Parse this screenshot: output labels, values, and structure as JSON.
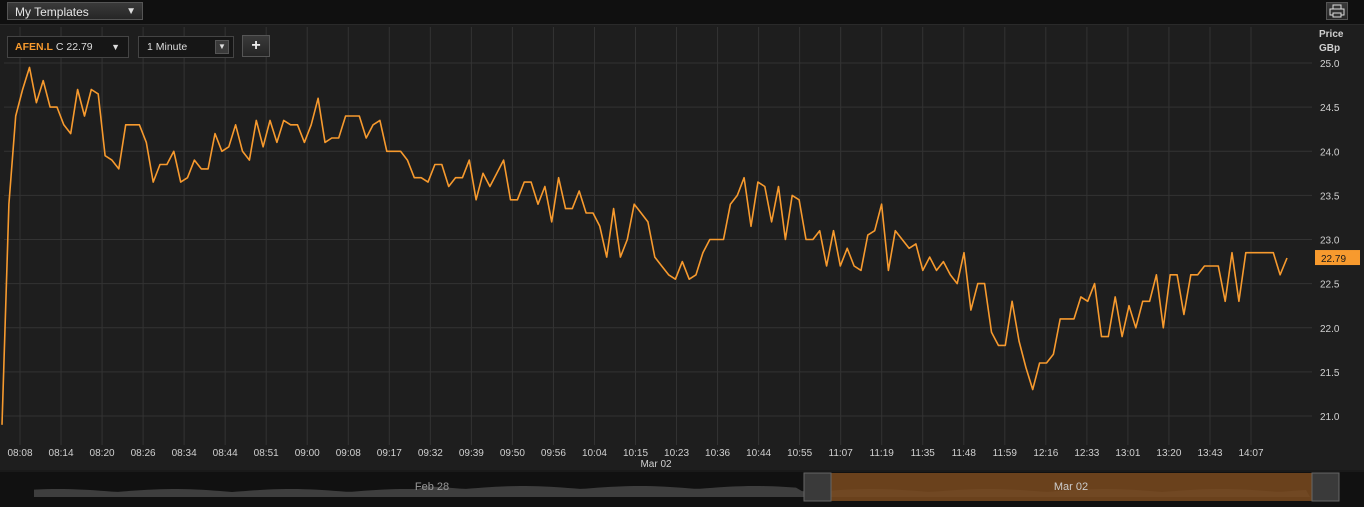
{
  "toolbar": {
    "template_label": "My Templates"
  },
  "instrument": {
    "ric": "AFEN.L",
    "close_prefix": "C",
    "close_value": "22.79"
  },
  "interval": {
    "label": "1 Minute"
  },
  "colors": {
    "line": "#f79a2e",
    "background": "#1e1e1e",
    "grid": "#333333",
    "navigator_selected": "#7a4a1e"
  },
  "chart_data": {
    "type": "line",
    "yaxis_label_1": "Price",
    "yaxis_label_2": "GBp",
    "ylim": [
      20.8,
      25.1
    ],
    "yticks": [
      "25.0",
      "24.5",
      "24.0",
      "23.5",
      "23.0",
      "22.5",
      "22.0",
      "21.5",
      "21.0"
    ],
    "last_value_label": "22.79",
    "last_value": 22.79,
    "xticks": [
      "08:08",
      "08:14",
      "08:20",
      "08:26",
      "08:34",
      "08:44",
      "08:51",
      "09:00",
      "09:08",
      "09:17",
      "09:32",
      "09:39",
      "09:50",
      "09:56",
      "10:04",
      "10:15",
      "10:23",
      "10:36",
      "10:44",
      "10:55",
      "11:07",
      "11:19",
      "11:35",
      "11:48",
      "11:59",
      "12:16",
      "12:33",
      "13:01",
      "13:20",
      "13:43",
      "14:07"
    ],
    "date_label": "Mar 02",
    "series": [
      {
        "values": [
          20.9,
          23.4,
          24.4,
          24.7,
          24.95,
          24.55,
          24.8,
          24.5,
          24.5,
          24.3,
          24.2,
          24.7,
          24.4,
          24.7,
          24.65,
          23.95,
          23.9,
          23.8,
          24.3,
          24.3,
          24.3,
          24.1,
          23.65,
          23.85,
          23.85,
          24.0,
          23.65,
          23.7,
          23.9,
          23.8,
          23.8,
          24.2,
          24.0,
          24.05,
          24.3,
          24.0,
          23.9,
          24.35,
          24.05,
          24.35,
          24.1,
          24.35,
          24.3,
          24.3,
          24.1,
          24.3,
          24.6,
          24.1,
          24.15,
          24.15,
          24.4,
          24.4,
          24.4,
          24.15,
          24.3,
          24.35,
          24.0,
          24.0,
          24.0,
          23.9,
          23.7,
          23.7,
          23.65,
          23.85,
          23.85,
          23.6,
          23.7,
          23.7,
          23.9,
          23.45,
          23.75,
          23.6,
          23.75,
          23.9,
          23.45,
          23.45,
          23.65,
          23.65,
          23.4,
          23.6,
          23.2,
          23.7,
          23.35,
          23.35,
          23.55,
          23.3,
          23.3,
          23.15,
          22.8,
          23.35,
          22.8,
          23.0,
          23.4,
          23.3,
          23.2,
          22.8,
          22.7,
          22.6,
          22.55,
          22.75,
          22.55,
          22.6,
          22.85,
          23.0,
          23.0,
          23.0,
          23.4,
          23.5,
          23.7,
          23.15,
          23.65,
          23.6,
          23.2,
          23.6,
          23.0,
          23.5,
          23.45,
          23.0,
          23.0,
          23.1,
          22.7,
          23.1,
          22.7,
          22.9,
          22.7,
          22.65,
          23.05,
          23.1,
          23.4,
          22.65,
          23.1,
          23.0,
          22.9,
          22.95,
          22.65,
          22.8,
          22.65,
          22.75,
          22.6,
          22.5,
          22.85,
          22.2,
          22.5,
          22.5,
          21.95,
          21.8,
          21.8,
          22.3,
          21.85,
          21.55,
          21.3,
          21.6,
          21.6,
          21.7,
          22.1,
          22.1,
          22.1,
          22.35,
          22.3,
          22.5,
          21.9,
          21.9,
          22.35,
          21.9,
          22.25,
          22.0,
          22.3,
          22.3,
          22.6,
          22.0,
          22.6,
          22.6,
          22.15,
          22.6,
          22.6,
          22.7,
          22.7,
          22.7,
          22.3,
          22.85,
          22.3,
          22.85,
          22.85,
          22.85,
          22.85,
          22.85,
          22.6,
          22.79
        ]
      }
    ]
  },
  "navigator": {
    "left_label": "Feb 28",
    "right_label": "Mar 02"
  }
}
